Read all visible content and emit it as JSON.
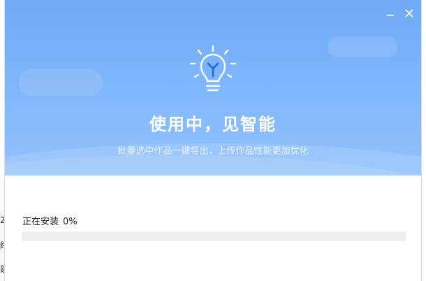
{
  "background_window": {
    "fragments": [
      "2",
      "终",
      "建"
    ]
  },
  "window_controls": {
    "minimize_icon": "minimize-icon",
    "close_icon": "close-icon"
  },
  "banner": {
    "icon": "lightbulb-icon",
    "title": "使用中，见智能",
    "subtitle": "批量选中作品一键导出，上传作品性能更加优化",
    "colors": {
      "top": "#70a9f8",
      "bottom": "#92c2fc",
      "text": "#ffffff"
    }
  },
  "install": {
    "status_label": "正在安装",
    "percent_text": "0%",
    "progress": 0,
    "track_color": "#efefef",
    "fill_color": "#5b9cf6"
  }
}
